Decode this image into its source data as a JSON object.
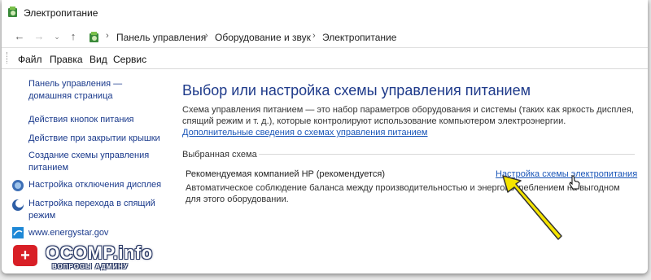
{
  "window": {
    "title": "Электропитание"
  },
  "address_bar": {
    "breadcrumbs": [
      "Панель управления",
      "Оборудование и звук",
      "Электропитание"
    ]
  },
  "menu": [
    "Файл",
    "Правка",
    "Вид",
    "Сервис"
  ],
  "sidebar": {
    "links": [
      {
        "label": "Панель управления — домашняя страница"
      },
      {
        "label": "Действия кнопок питания"
      },
      {
        "label": "Действие при закрытии крышки"
      },
      {
        "label": "Создание схемы управления питанием"
      },
      {
        "label": "Настройка отключения дисплея",
        "icon": "display-power-icon"
      },
      {
        "label": "Настройка перехода в спящий режим",
        "icon": "sleep-moon-icon"
      },
      {
        "label": "www.energystar.gov",
        "icon": "energystar-icon"
      }
    ]
  },
  "main": {
    "title": "Выбор или настройка схемы управления питанием",
    "description": "Схема управления питанием — это набор параметров оборудования и системы (таких как яркость дисплея, спящий режим и т. д.), которые контролируют использование компьютером электроэнергии.",
    "description_link": "Дополнительные сведения о схемах управления питанием",
    "group_label": "Выбранная схема",
    "plan": {
      "name": "Рекомендуемая компанией HP (рекомендуется)",
      "settings_link": "Настройка схемы электропитания",
      "description": "Автоматическое соблюдение баланса между производительностью и энергопотреблением на выгодном для этого оборудовании."
    }
  },
  "watermark": {
    "brand": "OCOMP.info",
    "tagline": "ВОПРОСЫ АДМИНУ"
  },
  "colors": {
    "link": "#1a56b8",
    "title": "#1e3a8a",
    "arrow": "#f5e400",
    "watermark_red": "#d81f26"
  }
}
